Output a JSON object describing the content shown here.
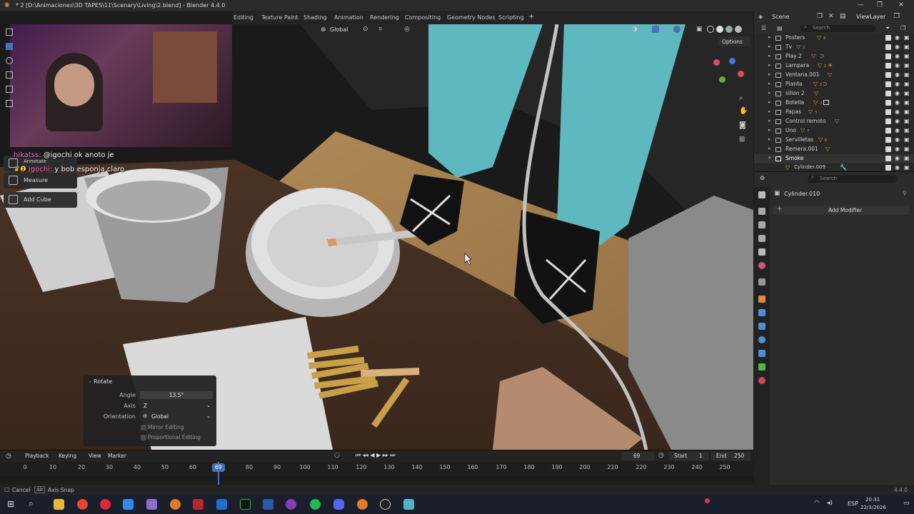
{
  "window": {
    "title": "* 2 [D:\\Animaciones\\3D TAPES\\11\\Scenary\\Living\\2.blend] - Blender 4.4.0",
    "min": "—",
    "max": "❐",
    "close": "✕"
  },
  "workspace_tabs": [
    "Editing",
    "Texture Paint",
    "Shading",
    "Animation",
    "Rendering",
    "Compositing",
    "Geometry Nodes",
    "Scripting",
    "+"
  ],
  "viewport": {
    "orientation_label": "Global",
    "options_label": "Options",
    "tools": [
      {
        "label": "Annotate"
      },
      {
        "label": "Measure"
      },
      {
        "label": "Add Cube"
      }
    ]
  },
  "stream_chat": [
    {
      "user": "hikatss:",
      "message": "@igochi ok anoto je",
      "color": "#ff6ad5"
    },
    {
      "user": "igochi:",
      "message": "y bob esponja claro",
      "color": "#ff6ad5"
    }
  ],
  "rotate_panel": {
    "title": "Rotate",
    "angle_label": "Angle",
    "angle_value": "13.5°",
    "axis_label": "Axis",
    "axis_value": "Z",
    "orientation_label": "Orientation",
    "orientation_value": "Global",
    "mirror_label": "Mirror Editing",
    "proportional_label": "Proportional Editing"
  },
  "timeline": {
    "menus": [
      "Playback",
      "Keying",
      "View",
      "Marker"
    ],
    "current_frame": "69",
    "start_label": "Start",
    "start_value": "1",
    "end_label": "End",
    "end_value": "250",
    "ticks": [
      "0",
      "10",
      "20",
      "30",
      "40",
      "50",
      "60",
      "69",
      "80",
      "90",
      "100",
      "110",
      "120",
      "130",
      "140",
      "150",
      "160",
      "170",
      "180",
      "190",
      "200",
      "210",
      "220",
      "230",
      "240",
      "250"
    ],
    "playhead_label": "69"
  },
  "statusbar": {
    "cancel": "Cancel",
    "alt_key": "Alt",
    "axis_snap": "Axis Snap",
    "version": "4.4.0"
  },
  "top_right": {
    "scene_label": "Scene",
    "view_layer_label": "ViewLayer"
  },
  "outliner": {
    "search_placeholder": "Search",
    "items": [
      {
        "name": "Posters",
        "badge": "9"
      },
      {
        "name": "Tv",
        "badge": "2"
      },
      {
        "name": "Play 2",
        "badge": ""
      },
      {
        "name": "Lampara",
        "badge": "2"
      },
      {
        "name": "Ventana.001",
        "badge": ""
      },
      {
        "name": "Planta",
        "badge": "2"
      },
      {
        "name": "sillon 2",
        "badge": ""
      },
      {
        "name": "Botella",
        "badge": "2"
      },
      {
        "name": "Papas",
        "badge": "3"
      },
      {
        "name": "Control remoto",
        "badge": ""
      },
      {
        "name": "Uno",
        "badge": "7"
      },
      {
        "name": "Servilletas",
        "badge": "8"
      },
      {
        "name": "Remera.001",
        "badge": ""
      },
      {
        "name": "Smoke",
        "badge": ""
      },
      {
        "name": "Cylinder.009",
        "badge": ""
      }
    ]
  },
  "properties": {
    "search_placeholder": "Search",
    "object_name": "Cylinder.010",
    "add_modifier_label": "Add Modifier"
  },
  "taskbar": {
    "clock_time": "20:31",
    "clock_date": "22/3/2026",
    "language": "ESP"
  },
  "colors": {
    "accent": "#4772b3",
    "playhead": "#4772b3",
    "ol_object": "#e09a3b",
    "ol_modifier": "#5fa8d8"
  }
}
